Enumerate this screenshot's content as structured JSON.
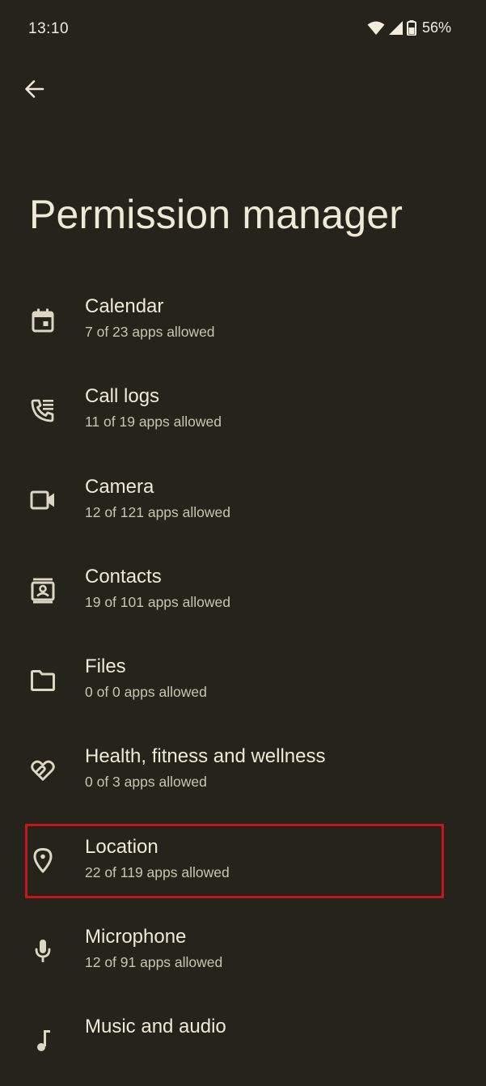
{
  "status_bar": {
    "time": "13:10",
    "battery_percent": "56%",
    "icons": [
      "wifi-icon",
      "cell-signal-icon",
      "battery-icon"
    ]
  },
  "header": {
    "back_icon": "arrow-back-icon",
    "title": "Permission manager"
  },
  "permissions": [
    {
      "icon": "calendar-icon",
      "title": "Calendar",
      "subtitle": "7 of 23 apps allowed"
    },
    {
      "icon": "call-log-icon",
      "title": "Call logs",
      "subtitle": "11 of 19 apps allowed"
    },
    {
      "icon": "camera-icon",
      "title": "Camera",
      "subtitle": "12 of 121 apps allowed"
    },
    {
      "icon": "contacts-icon",
      "title": "Contacts",
      "subtitle": "19 of 101 apps allowed"
    },
    {
      "icon": "folder-icon",
      "title": "Files",
      "subtitle": "0 of 0 apps allowed"
    },
    {
      "icon": "health-icon",
      "title": "Health, fitness and wellness",
      "subtitle": "0 of 3 apps allowed"
    },
    {
      "icon": "location-pin-icon",
      "title": "Location",
      "subtitle": "22 of 119 apps allowed",
      "highlighted": true
    },
    {
      "icon": "microphone-icon",
      "title": "Microphone",
      "subtitle": "12 of 91 apps allowed"
    },
    {
      "icon": "music-note-icon",
      "title": "Music and audio",
      "subtitle": ""
    }
  ],
  "colors": {
    "background": "#25231a",
    "text_primary": "#efe9d8",
    "text_secondary": "#c9c4b2",
    "highlight_border": "#c4161c"
  }
}
